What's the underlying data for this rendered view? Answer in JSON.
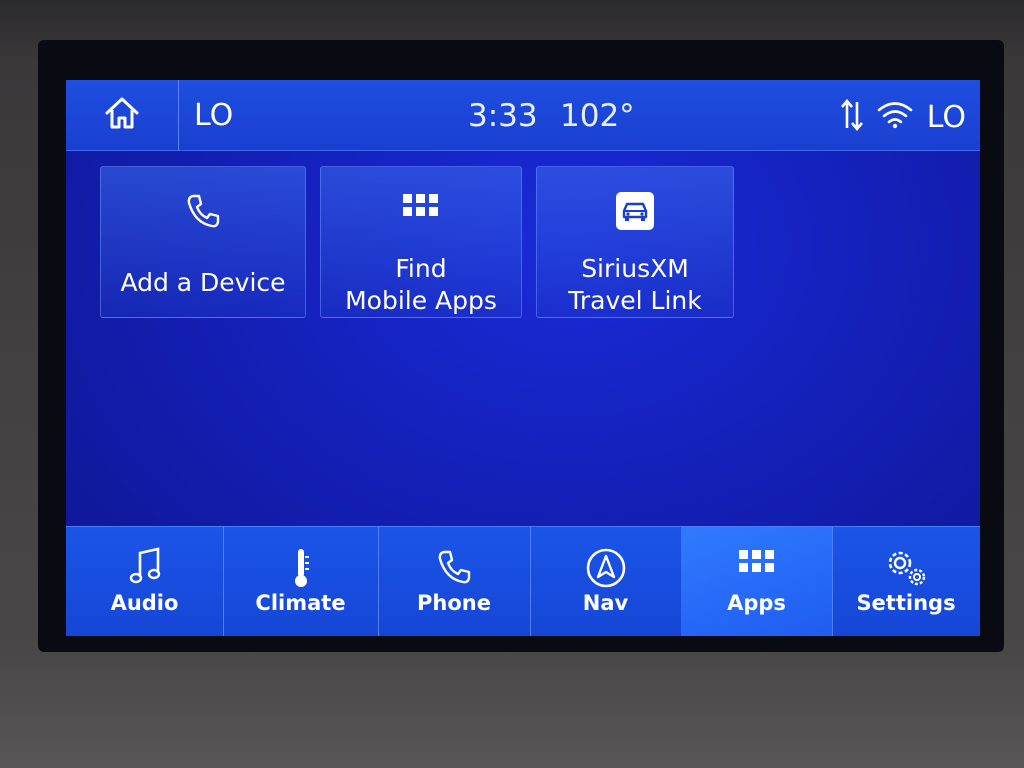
{
  "status": {
    "home_icon": "home-icon",
    "left_temp": "LO",
    "time": "3:33",
    "outside_temp": "102°",
    "right_temp": "LO",
    "icons": [
      "data-transfer-icon",
      "wifi-icon"
    ]
  },
  "apps": [
    {
      "label": "Add a Device",
      "icon": "phone-icon"
    },
    {
      "label_line1": "Find",
      "label_line2": "Mobile Apps",
      "icon": "app-grid-icon"
    },
    {
      "label_line1": "SiriusXM",
      "label_line2": "Travel Link",
      "icon": "car-icon"
    }
  ],
  "nav": [
    {
      "label": "Audio",
      "icon": "music-note-icon"
    },
    {
      "label": "Climate",
      "icon": "thermometer-icon"
    },
    {
      "label": "Phone",
      "icon": "phone-icon"
    },
    {
      "label": "Nav",
      "icon": "compass-arrow-icon"
    },
    {
      "label": "Apps",
      "icon": "app-grid-icon",
      "active": true
    },
    {
      "label": "Settings",
      "icon": "gears-icon"
    }
  ],
  "colors": {
    "screen_blue": "#1420b8",
    "bar_blue": "#1a55e8",
    "active_tab": "#2f7bff"
  }
}
